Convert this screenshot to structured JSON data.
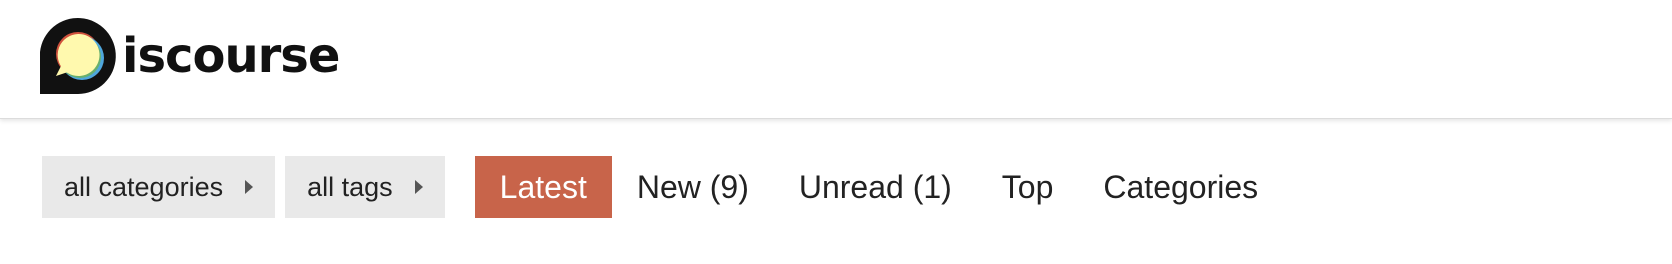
{
  "brand": {
    "logo_text": "iscourse",
    "logo_icon": "discourse-logo-icon"
  },
  "filters": [
    {
      "label": "all categories",
      "icon": "caret-right-icon"
    },
    {
      "label": "all tags",
      "icon": "caret-right-icon"
    }
  ],
  "tabs": [
    {
      "label": "Latest",
      "active": true
    },
    {
      "label": "New (9)",
      "active": false
    },
    {
      "label": "Unread (1)",
      "active": false
    },
    {
      "label": "Top",
      "active": false
    },
    {
      "label": "Categories",
      "active": false
    }
  ],
  "colors": {
    "accent": "#c8644a",
    "dropdown_bg": "#e9e9e9",
    "text": "#222222",
    "logo_dark": "#111111",
    "logo_bubble_yellow": "#fff9ae",
    "logo_bubble_red": "#d0523d",
    "logo_bubble_blue": "#4fa7dd",
    "logo_bubble_green": "#69b06d"
  }
}
